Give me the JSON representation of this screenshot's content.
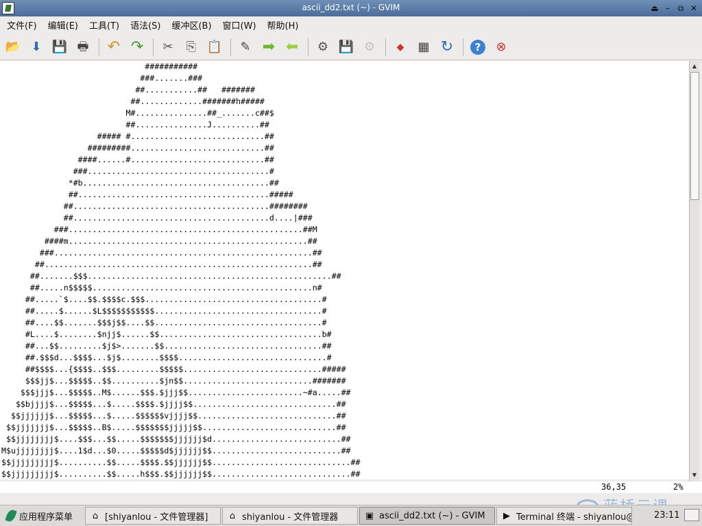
{
  "window": {
    "title": "ascii_dd2.txt (~) - GVIM",
    "controls": [
      "⏏",
      "–",
      "⧉",
      "✕"
    ]
  },
  "menu": [
    "文件(F)",
    "编辑(E)",
    "工具(T)",
    "语法(S)",
    "缓冲区(B)",
    "窗口(W)",
    "帮助(H)"
  ],
  "toolbar": [
    {
      "icon": "open-folder-icon",
      "glyph": "📂"
    },
    {
      "icon": "download-icon",
      "glyph": "⬇"
    },
    {
      "icon": "save-icon",
      "glyph": "💾"
    },
    {
      "icon": "print-icon",
      "glyph": "🖶"
    },
    {
      "icon": "undo-icon",
      "glyph": "↶"
    },
    {
      "icon": "redo-icon",
      "glyph": "↷"
    },
    {
      "icon": "cut-icon",
      "glyph": "✂"
    },
    {
      "icon": "copy-icon",
      "glyph": "⎘"
    },
    {
      "icon": "paste-icon",
      "glyph": "📋"
    },
    {
      "icon": "find-replace-icon",
      "glyph": "✎"
    },
    {
      "icon": "find-next-icon",
      "glyph": "➡"
    },
    {
      "icon": "find-prev-icon",
      "glyph": "⬅"
    },
    {
      "icon": "load-session-icon",
      "glyph": "⚙"
    },
    {
      "icon": "save-session-icon",
      "glyph": "💾"
    },
    {
      "icon": "run-script-icon",
      "glyph": "⚙"
    },
    {
      "icon": "make-icon",
      "glyph": "◆"
    },
    {
      "icon": "build-tags-icon",
      "glyph": "▦"
    },
    {
      "icon": "jump-tag-icon",
      "glyph": "↻"
    },
    {
      "icon": "help-icon",
      "glyph": "?"
    },
    {
      "icon": "find-help-icon",
      "glyph": "⊗"
    }
  ],
  "editor": {
    "lines": [
      "                              ###########",
      "                             ###.......###",
      "                            ##...........##   #######",
      "                           ##.............#######h#####",
      "                          M#...............##_.......c##$",
      "                          ##...............J..........##",
      "                    ##### #............................##",
      "                  #########............................##",
      "                ####......#............................##",
      "               ###......................................#",
      "              *#b.......................................##",
      "              ##........................................#####",
      "             ##.........................................########",
      "             ##.........................................d....|###",
      "           ###.................................................##M",
      "         ####m..................................................##",
      "        ###......................................................##",
      "       ##........................................................##",
      "      ##.......$$$...................................................##",
      "      ##.....n$$$$$..............................................n#",
      "     ##.....`$....$$.$$$$c.$$$.....................................#",
      "     ##.....$......$L$$$$$$$$$$$...................................#",
      "     ##....$$.......$$$j$$....$$...................................#",
      "     #L....$........$njj$......$$..................................b#",
      "     ##...$$.........$j$>.......$$.................................##",
      "     ##.$$$d...$$$$...$j$........$$$$...............................#",
      "     ##$$$$...{$$$$..$$$.........$$$$$.............................#####",
      "     $$$jj$...$$$$$..$$..........$jn$$...........................#######",
      "    $$$jjj$...$$$$$..M$......$$$.$jjj$$........................~#a.....##",
      "   $$bjjjj$...$$$$$...$.....$$$$.$jjjj$$..............................##",
      "  $$jjjjjj$...$$$$$...$.....$$$$$$vjjjj$$.............................##",
      " $$jjjjjjj$...$$$$$..B$.....$$$$$$$jjjjj$$............................##",
      " $$jjjjjjjj$....$$$...$$.....$$$$$$$jjjjjj$d...........................##",
      "M$ujjjjjjjj$....1$d...$0.....$$$$$d$jjjjjj$$...........................##",
      "$$jjjjjjjjj$..........$$.....$$$$.$$jjjjjj$$.............................##",
      "$$jjjjjjjjj$..........$$.....h$$$.$$jjjjjj$$.............................##"
    ]
  },
  "status": {
    "cursor": "36,35",
    "percent": "2%"
  },
  "watermark": "蓝桥云课",
  "taskbar": {
    "start_label": "应用程序菜单",
    "tasks": [
      {
        "label": "[shiyanlou - 文件管理器]",
        "icon": "home-folder-icon",
        "glyph": "⌂",
        "active": false
      },
      {
        "label": "shiyanlou - 文件管理器",
        "icon": "home-folder-icon",
        "glyph": "⌂",
        "active": false
      },
      {
        "label": "ascii_dd2.txt (~) - GVIM",
        "icon": "gvim-icon",
        "glyph": "▣",
        "active": true
      },
      {
        "label": "Terminal 终端 - shiyanlou@…",
        "icon": "terminal-icon",
        "glyph": "▶",
        "active": false
      }
    ],
    "clock": "23:11"
  }
}
